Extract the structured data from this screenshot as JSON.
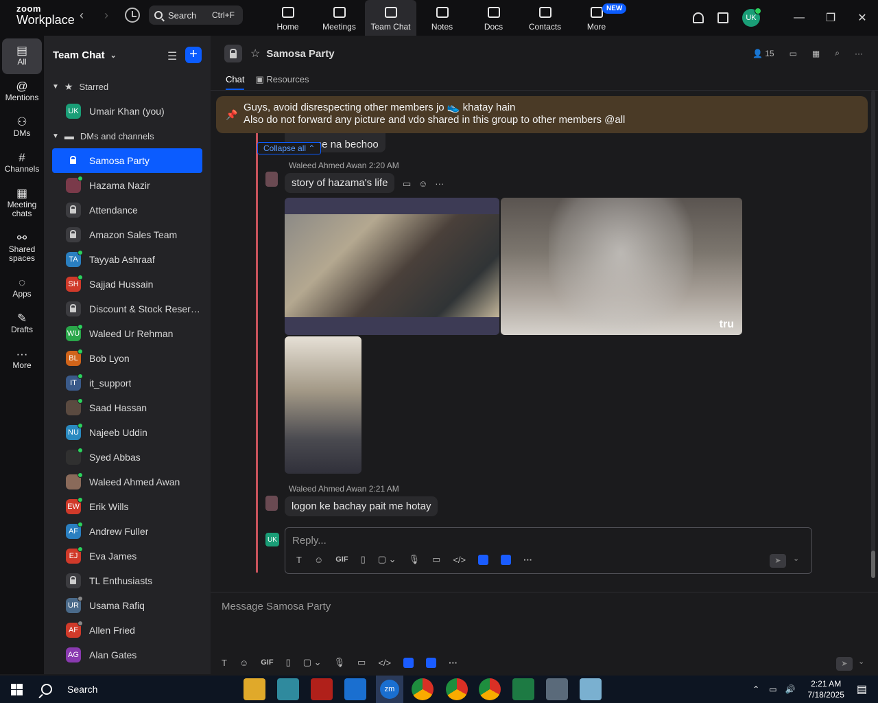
{
  "brand": {
    "line1": "zoom",
    "line2": "Workplace"
  },
  "search": {
    "label": "Search",
    "shortcut": "Ctrl+F"
  },
  "topnav": [
    {
      "label": "Home",
      "icon": "home-icon"
    },
    {
      "label": "Meetings",
      "icon": "video-icon"
    },
    {
      "label": "Team Chat",
      "icon": "chat-icon",
      "active": true
    },
    {
      "label": "Notes",
      "icon": "notes-icon"
    },
    {
      "label": "Docs",
      "icon": "docs-icon"
    },
    {
      "label": "Contacts",
      "icon": "contacts-icon"
    },
    {
      "label": "More",
      "icon": "more-icon",
      "badge": "NEW"
    }
  ],
  "user_initials": "UK",
  "rail": [
    {
      "label": "All",
      "glyph": "▤",
      "active": true
    },
    {
      "label": "Mentions",
      "glyph": "@"
    },
    {
      "label": "DMs",
      "glyph": "⚇"
    },
    {
      "label": "Channels",
      "glyph": "#"
    },
    {
      "label": "Meeting chats",
      "glyph": "▦"
    },
    {
      "label": "Shared spaces",
      "glyph": "⚯"
    },
    {
      "label": "Apps",
      "glyph": "◌"
    },
    {
      "label": "Drafts",
      "glyph": "✎"
    },
    {
      "label": "More",
      "glyph": "···"
    }
  ],
  "sidebar": {
    "title": "Team Chat",
    "starred_label": "Starred",
    "starred": [
      {
        "name": "Umair Khan (you)",
        "initials": "UK",
        "color": "#1a9e77"
      }
    ],
    "dms_label": "DMs and channels",
    "items": [
      {
        "name": "Samosa Party",
        "type": "lock",
        "selected": true
      },
      {
        "name": "Hazama Nazir",
        "initials": "",
        "color": "#7a3a4a",
        "status": "on"
      },
      {
        "name": "Attendance",
        "type": "lock"
      },
      {
        "name": "Amazon Sales Team",
        "type": "lock"
      },
      {
        "name": "Tayyab Ashraaf",
        "initials": "TA",
        "color": "#2a7fc0",
        "status": "on"
      },
      {
        "name": "Sajjad Hussain",
        "initials": "SH",
        "color": "#d03a2a",
        "status": "on"
      },
      {
        "name": "Discount & Stock Reservati...",
        "type": "lock"
      },
      {
        "name": "Waleed Ur Rehman",
        "initials": "WU",
        "color": "#2aa64a",
        "status": "on"
      },
      {
        "name": "Bob Lyon",
        "initials": "BL",
        "color": "#d0641a",
        "status": "on"
      },
      {
        "name": "it_support",
        "initials": "IT",
        "color": "#3a5a8a",
        "status": "on"
      },
      {
        "name": "Saad Hassan",
        "initials": "",
        "color": "#5a4a40",
        "status": "on"
      },
      {
        "name": "Najeeb Uddin",
        "initials": "NU",
        "color": "#2a8ac0",
        "status": "on"
      },
      {
        "name": "Syed Abbas",
        "initials": "",
        "color": "#303030",
        "status": "on"
      },
      {
        "name": "Waleed Ahmed Awan",
        "initials": "",
        "color": "#8a6a5a",
        "status": "on"
      },
      {
        "name": "Erik Wills",
        "initials": "EW",
        "color": "#d03a2a",
        "status": "on"
      },
      {
        "name": "Andrew Fuller",
        "initials": "AF",
        "color": "#2a7fc0",
        "status": "on"
      },
      {
        "name": "Eva James",
        "initials": "EJ",
        "color": "#d03a2a",
        "status": "on"
      },
      {
        "name": "TL Enthusiasts",
        "type": "lock"
      },
      {
        "name": "Usama Rafiq",
        "initials": "UR",
        "color": "#4a6a8a",
        "status": "off"
      },
      {
        "name": "Allen Fried",
        "initials": "AF",
        "color": "#d03a2a",
        "status": "off"
      },
      {
        "name": "Alan Gates",
        "initials": "AG",
        "color": "#8a3ab0",
        "status": ""
      }
    ]
  },
  "channel": {
    "title": "Samosa Party",
    "member_count": "15",
    "tabs": [
      "Chat",
      "Resources"
    ],
    "pinned_line1": "Guys, avoid disrespecting other members jo 👟 khatay hain",
    "pinned_line2": "Also do not forward any picture and vdo shared in this group to other members @all",
    "prev_message": "new me na bechoo",
    "collapse_label": "Collapse all ⌃",
    "messages": [
      {
        "sender": "Waleed Ahmed Awan",
        "time": "2:20 AM",
        "text": "story of hazama's life"
      },
      {
        "sender": "Waleed Ahmed Awan",
        "time": "2:21 AM",
        "text": "logon ke bachay pait me hotay"
      }
    ],
    "image_watermark": "tru",
    "reply_placeholder": "Reply...",
    "composer_placeholder": "Message Samosa Party",
    "gif_label": "GIF"
  },
  "taskbar": {
    "search_label": "Search",
    "time": "2:21 AM",
    "date": "7/18/2025"
  }
}
